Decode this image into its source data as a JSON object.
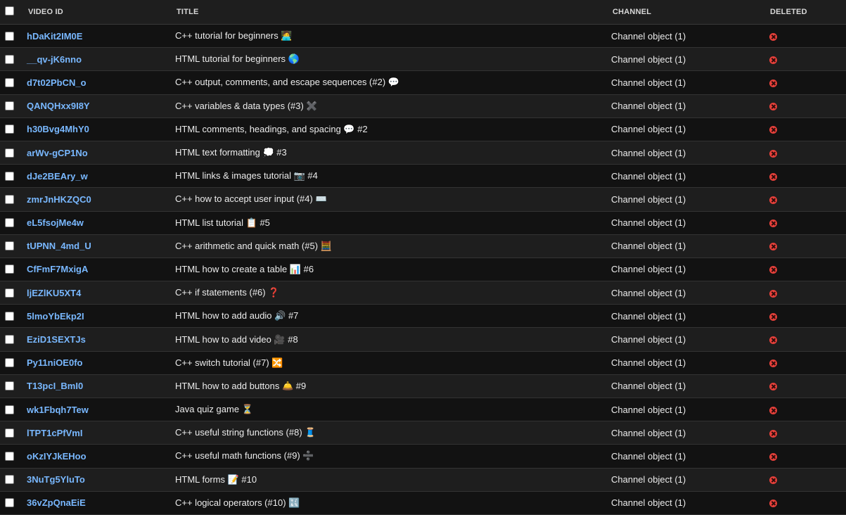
{
  "header": {
    "video_id": "VIDEO ID",
    "title": "TITLE",
    "channel": "CHANNEL",
    "deleted": "DELETED"
  },
  "rows": [
    {
      "video_id": "hDaKit2IM0E",
      "title": "C++ tutorial for beginners 🧑‍💻",
      "channel": "Channel object (1)"
    },
    {
      "video_id": "__qv-jK6nno",
      "title": "HTML tutorial for beginners 🌎",
      "channel": "Channel object (1)"
    },
    {
      "video_id": "d7t02PbCN_o",
      "title": "C++ output, comments, and escape sequences (#2) 💬",
      "channel": "Channel object (1)"
    },
    {
      "video_id": "QANQHxx9I8Y",
      "title": "C++ variables & data types (#3) ✖️",
      "channel": "Channel object (1)"
    },
    {
      "video_id": "h30Bvg4MhY0",
      "title": "HTML comments, headings, and spacing 💬 #2",
      "channel": "Channel object (1)"
    },
    {
      "video_id": "arWv-gCP1No",
      "title": "HTML text formatting 💭 #3",
      "channel": "Channel object (1)"
    },
    {
      "video_id": "dJe2BEAry_w",
      "title": "HTML links & images tutorial 📷 #4",
      "channel": "Channel object (1)"
    },
    {
      "video_id": "zmrJnHKZQC0",
      "title": "C++ how to accept user input (#4) ⌨️",
      "channel": "Channel object (1)"
    },
    {
      "video_id": "eL5fsojMe4w",
      "title": "HTML list tutorial 📋 #5",
      "channel": "Channel object (1)"
    },
    {
      "video_id": "tUPNN_4md_U",
      "title": "C++ arithmetic and quick math (#5) 🧮",
      "channel": "Channel object (1)"
    },
    {
      "video_id": "CfFmF7MxigA",
      "title": "HTML how to create a table 📊 #6",
      "channel": "Channel object (1)"
    },
    {
      "video_id": "ljEZlKU5XT4",
      "title": "C++ if statements (#6) ❓",
      "channel": "Channel object (1)"
    },
    {
      "video_id": "5lmoYbEkp2I",
      "title": "HTML how to add audio 🔊 #7",
      "channel": "Channel object (1)"
    },
    {
      "video_id": "EziD1SEXTJs",
      "title": "HTML how to add video 🎥 #8",
      "channel": "Channel object (1)"
    },
    {
      "video_id": "Py11niOE0fo",
      "title": "C++ switch tutorial (#7) 🔀",
      "channel": "Channel object (1)"
    },
    {
      "video_id": "T13pcI_BmI0",
      "title": "HTML how to add buttons 🛎️ #9",
      "channel": "Channel object (1)"
    },
    {
      "video_id": "wk1Fbqh7Tew",
      "title": "Java quiz game ⏳",
      "channel": "Channel object (1)"
    },
    {
      "video_id": "lTPT1cPfVmI",
      "title": "C++ useful string functions (#8) 🧵",
      "channel": "Channel object (1)"
    },
    {
      "video_id": "oKzIYJkEHoo",
      "title": "C++ useful math functions (#9) ➗",
      "channel": "Channel object (1)"
    },
    {
      "video_id": "3NuTg5YluTo",
      "title": "HTML forms 📝 #10",
      "channel": "Channel object (1)"
    },
    {
      "video_id": "36vZpQnaEiE",
      "title": "C++ logical operators (#10) 🔣",
      "channel": "Channel object (1)"
    }
  ],
  "colors": {
    "link": "#79b8ff",
    "deleted_icon": "#e5403a",
    "row_odd": "#121212",
    "row_even": "#1e1e1e"
  },
  "icons": {
    "deleted": "delete-x-circle-icon"
  }
}
